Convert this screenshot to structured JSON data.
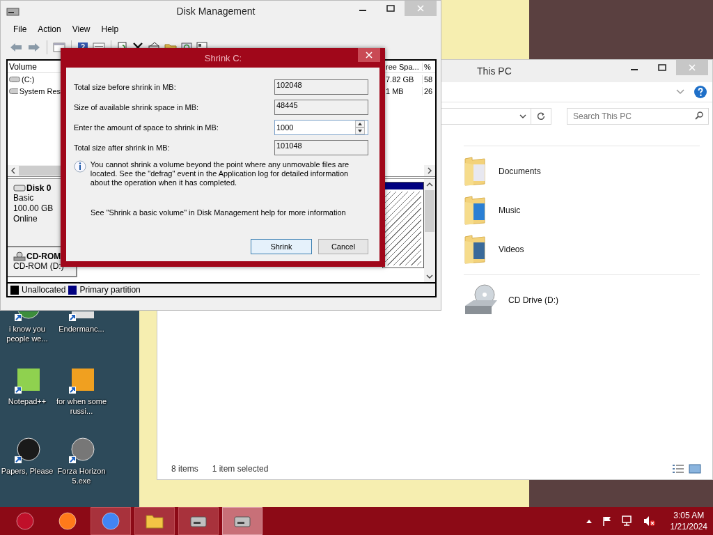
{
  "desktop_icons": [
    {
      "label": "i know you people we...",
      "kind": "chrome"
    },
    {
      "label": "Endermanc...",
      "kind": "generic"
    },
    {
      "label": "Notepad++",
      "kind": "notepad"
    },
    {
      "label": "for when some russi...",
      "kind": "de"
    },
    {
      "label": "Papers, Please",
      "kind": "papers"
    },
    {
      "label": "Forza Horizon 5.exe",
      "kind": "flash"
    }
  ],
  "explorer": {
    "title": "This PC",
    "search": {
      "placeholder": "Search This PC"
    },
    "folders": [
      {
        "label": "Documents",
        "kind": "documents"
      },
      {
        "label": "Music",
        "kind": "music"
      },
      {
        "label": "Videos",
        "kind": "videos"
      }
    ],
    "drives": [
      {
        "label": "CD Drive (D:)"
      }
    ],
    "status_bar": [
      "8 items",
      "1 item selected"
    ]
  },
  "disk_management": {
    "title": "Disk Management",
    "menu": [
      "File",
      "Action",
      "View",
      "Help"
    ],
    "volume_table": {
      "columns": [
        "Volume",
        "ree Spa...",
        "%"
      ],
      "rows": [
        {
          "volume": "(C:)",
          "free": "7.82 GB",
          "percent": "58"
        },
        {
          "volume": "System Res",
          "free": "1 MB",
          "percent": "26"
        }
      ]
    },
    "disks": [
      {
        "name": "Disk 0",
        "kind": "disk",
        "lines": [
          "Basic",
          "100.00 GB",
          "Online"
        ]
      },
      {
        "name": "CD-ROM",
        "kind": "cdrom",
        "lines": [
          "CD-ROM (D:)"
        ]
      }
    ],
    "legend": [
      {
        "label": "Unallocated",
        "color": "#000000"
      },
      {
        "label": "Primary partition",
        "color": "#000080"
      }
    ]
  },
  "shrink_dialog": {
    "title": "Shrink C:",
    "fields": [
      {
        "label": "Total size before shrink in MB:",
        "value": "102048",
        "kind": "readonly"
      },
      {
        "label": "Size of available shrink space in MB:",
        "value": "48445",
        "kind": "readonly"
      },
      {
        "label": "Enter the amount of space to shrink in MB:",
        "value": "1000",
        "kind": "spin"
      },
      {
        "label": "Total size after shrink in MB:",
        "value": "101048",
        "kind": "readonly"
      }
    ],
    "info": "You cannot shrink a volume beyond the point where any unmovable files are located. See the \"defrag\" event in the Application log for detailed information about the operation when it has completed.",
    "help": "See \"Shrink a basic volume\" in Disk Management help for more information",
    "buttons": [
      {
        "label": "Shrink",
        "default": true
      },
      {
        "label": "Cancel",
        "default": false
      }
    ]
  },
  "taskbar": {
    "apps": [
      {
        "kind": "start",
        "running": false,
        "selected": false
      },
      {
        "kind": "firefox",
        "running": false,
        "selected": false
      },
      {
        "kind": "chrome",
        "running": true,
        "selected": false
      },
      {
        "kind": "explorer",
        "running": true,
        "selected": false
      },
      {
        "kind": "disk",
        "running": true,
        "selected": false
      },
      {
        "kind": "disk",
        "running": true,
        "selected": true
      }
    ],
    "time": "3:05 AM",
    "date": "1/21/2024"
  }
}
